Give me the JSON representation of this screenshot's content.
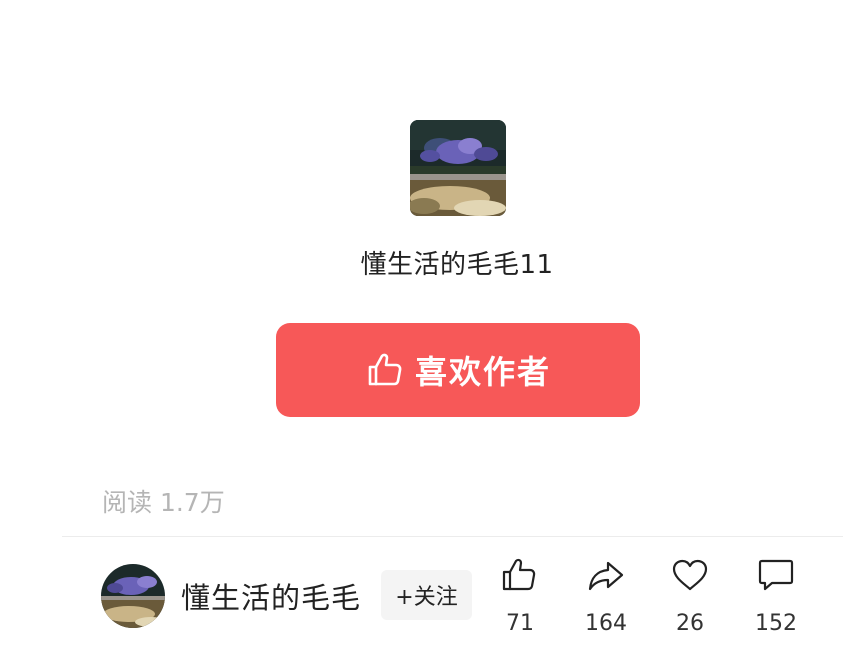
{
  "author": {
    "name": "懂生活的毛毛11",
    "display_name": "懂生活的毛毛"
  },
  "like_author_button": {
    "label": "喜欢作者",
    "icon": "thumbs-up-icon"
  },
  "read_count": "阅读 1.7万",
  "follow_button": {
    "label": "+关注"
  },
  "actions": {
    "like": {
      "icon": "thumbs-up-icon",
      "count": "71"
    },
    "share": {
      "icon": "share-arrow-icon",
      "count": "164"
    },
    "favorite": {
      "icon": "heart-icon",
      "count": "26"
    },
    "comment": {
      "icon": "comment-bubble-icon",
      "count": "152"
    }
  },
  "colors": {
    "primary_red": "#f75858",
    "muted_text": "#b5b5b5",
    "text": "#222222"
  }
}
